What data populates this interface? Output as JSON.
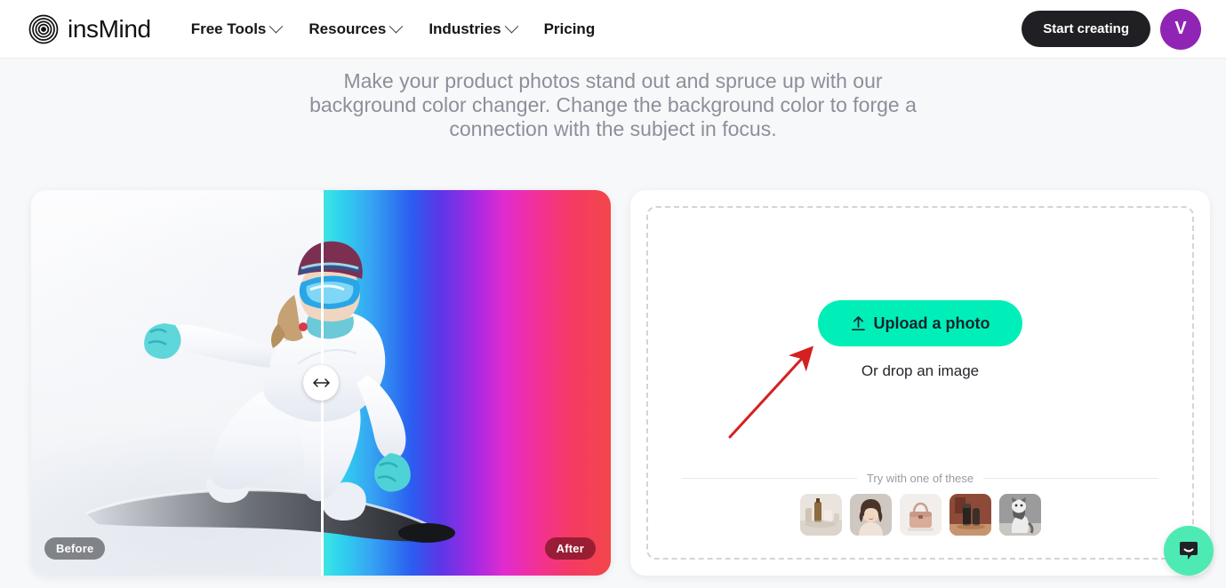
{
  "header": {
    "logo_text": "insMind",
    "logo_icon": "concentric-rings-logo-icon",
    "nav": [
      {
        "label": "Free Tools",
        "has_dropdown": true
      },
      {
        "label": "Resources",
        "has_dropdown": true
      },
      {
        "label": "Industries",
        "has_dropdown": true
      },
      {
        "label": "Pricing",
        "has_dropdown": false
      }
    ],
    "start_button": "Start creating",
    "avatar_initial": "V",
    "avatar_color": "#9024b4",
    "start_button_color": "#202024"
  },
  "headline": "Make your product photos stand out and spruce up with our background color changer. Change the background color to forge a connection with the subject in focus.",
  "comparison": {
    "before_label": "Before",
    "after_label": "After",
    "handle_icon": "horizontal-resize-arrows-icon",
    "before_description": "snowboarder on white snow background",
    "after_description": "snowboarder on rainbow gradient background",
    "divider_position_percent": 50,
    "after_gradient": [
      "#3fe8e0",
      "#2a5ef0",
      "#a32ae2",
      "#f2309a",
      "#f2474a"
    ]
  },
  "upload": {
    "button_label": "Upload a photo",
    "button_icon": "upload-arrow-icon",
    "button_color": "#00efb8",
    "drop_text": "Or drop an image",
    "try_label": "Try with one of these",
    "samples": [
      {
        "name": "cosmetics-bottles-thumbnail"
      },
      {
        "name": "woman-portrait-thumbnail"
      },
      {
        "name": "pink-handbag-thumbnail"
      },
      {
        "name": "dark-tubes-thumbnail"
      },
      {
        "name": "cat-thumbnail"
      }
    ]
  },
  "annotation": {
    "arrow_color": "#d42020",
    "arrow_description": "red arrow pointing to upload button"
  },
  "chat": {
    "icon": "chat-bubble-smile-icon",
    "color": "#4eeab4"
  }
}
